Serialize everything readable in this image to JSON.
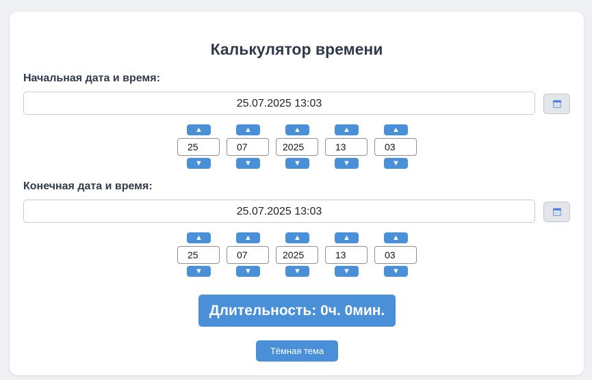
{
  "title": "Калькулятор времени",
  "start": {
    "label": "Начальная дата и время:",
    "value": "25.07.2025 13:03",
    "day": "25",
    "month": "07",
    "year": "2025",
    "hour": "13",
    "minute": "03"
  },
  "end": {
    "label": "Конечная дата и время:",
    "value": "25.07.2025 13:03",
    "day": "25",
    "month": "07",
    "year": "2025",
    "hour": "13",
    "minute": "03"
  },
  "arrows": {
    "up": "▲",
    "down": "▼"
  },
  "duration": "Длительность: 0ч. 0мин.",
  "theme_button": "Тёмная тема",
  "icons": {
    "calendar": "calendar-icon"
  },
  "colors": {
    "accent": "#4a90d9",
    "background": "#eef0f4",
    "card": "#ffffff"
  }
}
